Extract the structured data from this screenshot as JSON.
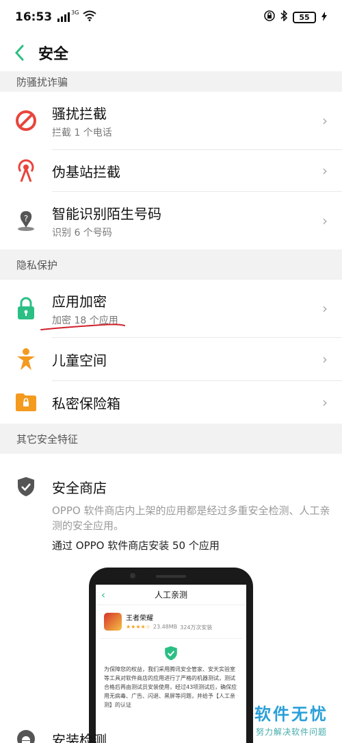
{
  "status_bar": {
    "time": "16:53",
    "network": "3G",
    "battery": "55"
  },
  "header": {
    "title": "安全"
  },
  "sections": {
    "anti_harass": "防骚扰诈骗",
    "privacy": "隐私保护",
    "other": "其它安全特征"
  },
  "items": {
    "harass_block": {
      "title": "骚扰拦截",
      "subtitle": "拦截 1 个电话"
    },
    "fake_station": {
      "title": "伪基站拦截"
    },
    "smart_id": {
      "title": "智能识别陌生号码",
      "subtitle": "识别 6 个号码"
    },
    "app_lock": {
      "title": "应用加密",
      "subtitle": "加密 18 个应用"
    },
    "kids_space": {
      "title": "儿童空间"
    },
    "private_box": {
      "title": "私密保险箱"
    }
  },
  "secure_store": {
    "title": "安全商店",
    "description": "OPPO 软件商店内上架的应用都是经过多重安全检测、人工亲测的安全应用。",
    "stat": "通过 OPPO 软件商店安装 50 个应用"
  },
  "phone_preview": {
    "title": "人工亲测",
    "app_name": "王者荣耀",
    "size": "23.48MB",
    "installs": "324万次安装",
    "note": "为保障您的权益，我们采用腾讯安全管家、安天实验室等工具对软件商店的应用进行了严格的机器测试，测试合格后再由测试员安装使用，经过43项测试后，确保应用无病毒、广告、闪退、黑屏等问题，并给予【人工亲测】的认证"
  },
  "install_check": {
    "title": "安装检测"
  },
  "watermark": {
    "line1": "软件无忧",
    "line2": "努力解决软件问题"
  },
  "colors": {
    "accent": "#2bbf84",
    "red": "#e8453c",
    "orange": "#f39a1f",
    "gray_icon": "#555"
  }
}
